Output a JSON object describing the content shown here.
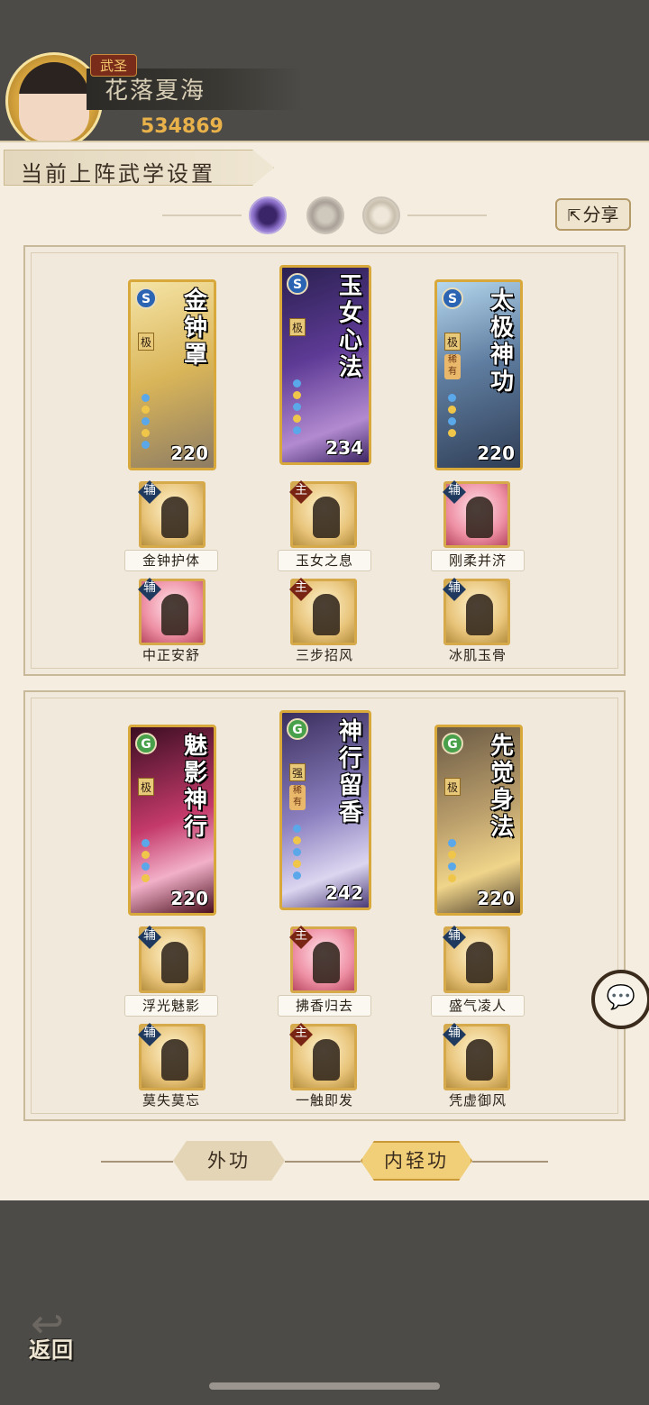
{
  "header": {
    "title_badge": "武圣",
    "player_name": "花落夏海",
    "power": "534869"
  },
  "panel": {
    "title": "当前上阵武学设置",
    "share_label": "分享"
  },
  "section1": {
    "cards": [
      {
        "name": "金钟罩",
        "value": "220",
        "tier": "极",
        "rare": "",
        "type": "S"
      },
      {
        "name": "玉女心法",
        "value": "234",
        "tier": "极",
        "rare": "",
        "type": "S"
      },
      {
        "name": "太极神功",
        "value": "220",
        "tier": "极",
        "rare": "稀有",
        "type": "S"
      }
    ],
    "skills_row1": [
      {
        "tag": "辅",
        "label": "金钟护体"
      },
      {
        "tag": "主",
        "label": "玉女之息"
      },
      {
        "tag": "辅",
        "label": "刚柔并济"
      }
    ],
    "skills_row2": [
      {
        "tag": "辅",
        "label": "中正安舒"
      },
      {
        "tag": "主",
        "label": "三步招风"
      },
      {
        "tag": "辅",
        "label": "冰肌玉骨"
      }
    ]
  },
  "section2": {
    "cards": [
      {
        "name": "魅影神行",
        "value": "220",
        "tier": "极",
        "rare": "",
        "type": "G"
      },
      {
        "name": "神行留香",
        "value": "242",
        "tier": "强",
        "rare": "稀有",
        "type": "G"
      },
      {
        "name": "先觉身法",
        "value": "220",
        "tier": "极",
        "rare": "",
        "type": "G"
      }
    ],
    "skills_row1": [
      {
        "tag": "辅",
        "label": "浮光魅影"
      },
      {
        "tag": "主",
        "label": "拂香归去"
      },
      {
        "tag": "辅",
        "label": "盛气凌人"
      }
    ],
    "skills_row2": [
      {
        "tag": "辅",
        "label": "莫失莫忘"
      },
      {
        "tag": "主",
        "label": "一触即发"
      },
      {
        "tag": "辅",
        "label": "凭虚御风"
      }
    ]
  },
  "tabs": {
    "outer": "外功",
    "inner": "内轻功"
  },
  "back_label": "返回",
  "icons": {
    "share": "share-icon",
    "chat": "chat-bubble-icon",
    "back": "back-arrow-icon"
  }
}
